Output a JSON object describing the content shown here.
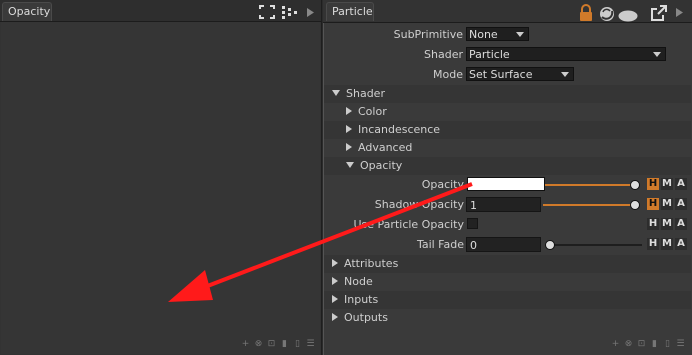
{
  "left_panel": {
    "tab_label": "Opacity"
  },
  "right_panel": {
    "tab_label": "Particle",
    "fields": {
      "subprimitive_label": "SubPrimitive",
      "subprimitive_value": "None",
      "shader_label": "Shader",
      "shader_value": "Particle",
      "mode_label": "Mode",
      "mode_value": "Set Surface"
    },
    "sections": {
      "shader": "Shader",
      "color": "Color",
      "incandescence": "Incandescence",
      "advanced": "Advanced",
      "opacity": "Opacity",
      "attributes": "Attributes",
      "node": "Node",
      "inputs": "Inputs",
      "outputs": "Outputs"
    },
    "opacity_params": {
      "opacity_label": "Opacity",
      "shadow_opacity_label": "Shadow Opacity",
      "shadow_opacity_value": "1",
      "use_particle_opacity_label": "Use Particle Opacity",
      "tail_fade_label": "Tail Fade",
      "tail_fade_value": "0"
    },
    "hma": {
      "h": "H",
      "m": "M",
      "a": "A"
    }
  },
  "colors": {
    "accent_orange": "#d07a2a",
    "annotation_red": "#ff1a1a"
  }
}
